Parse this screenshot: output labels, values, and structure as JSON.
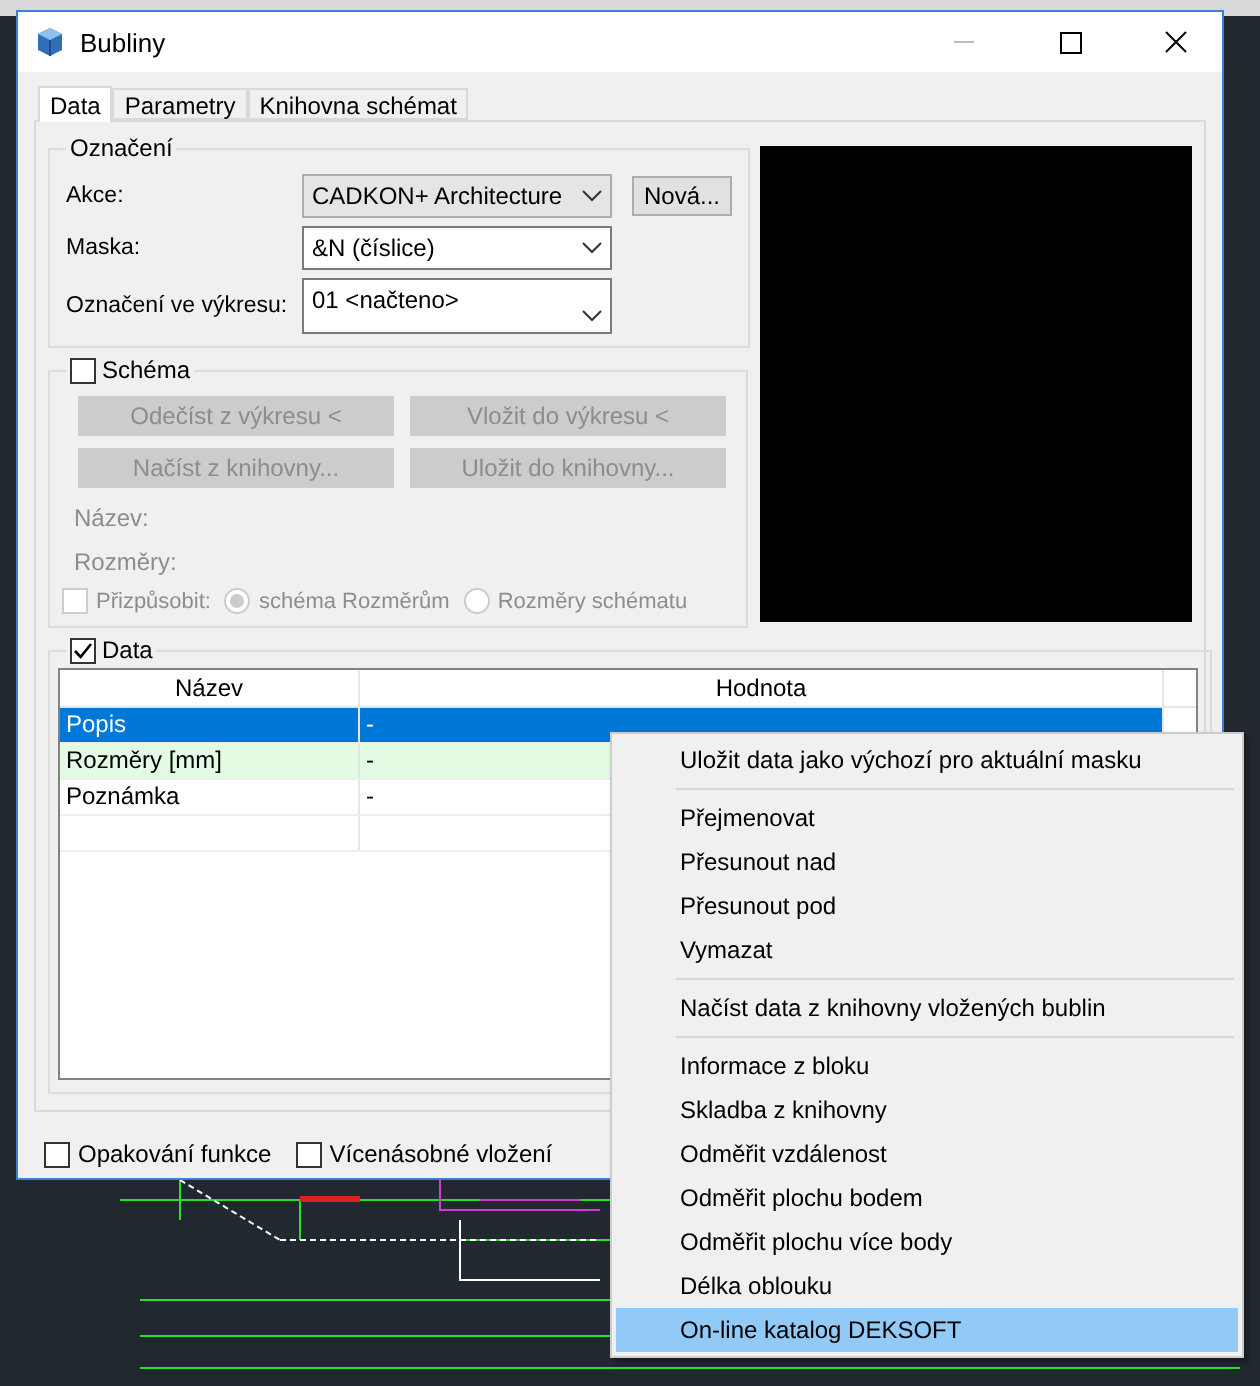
{
  "window": {
    "title": "Bubliny"
  },
  "tabs": [
    {
      "label": "Data",
      "selected": true
    },
    {
      "label": "Parametry",
      "selected": false
    },
    {
      "label": "Knihovna schémat",
      "selected": false
    }
  ],
  "oznaceni": {
    "title": "Označení",
    "fields": [
      {
        "label": "Akce:",
        "value": "CADKON+ Architecture",
        "kind": "combo"
      },
      {
        "label": "Maska:",
        "value": "&N (číslice)",
        "kind": "dropdown"
      },
      {
        "label": "Označení ve výkresu:",
        "value": "01 <načteno>",
        "kind": "tall"
      }
    ],
    "new_button": "Nová..."
  },
  "schema": {
    "title": "Schéma",
    "checked": false,
    "disabled": true,
    "buttons": [
      "Odečíst z výkresu <",
      "Vložit do výkresu <",
      "Načíst z knihovny...",
      "Uložit do knihovny..."
    ],
    "labels": [
      "Název:",
      "Rozměry:"
    ],
    "fit": {
      "label": "Přizpůsobit:",
      "checked": false
    },
    "radios": [
      {
        "label": "schéma Rozměrům",
        "selected": true
      },
      {
        "label": "Rozměry schématu",
        "selected": false
      }
    ]
  },
  "data": {
    "title": "Data",
    "checked": true,
    "columns": [
      "Název",
      "Hodnota"
    ],
    "rows": [
      {
        "name": "Popis",
        "value": "-",
        "selected": true,
        "highlighted": false
      },
      {
        "name": "Rozměry [mm]",
        "value": "-",
        "selected": false,
        "highlighted": true
      },
      {
        "name": "Poznámka",
        "value": "-",
        "selected": false,
        "highlighted": false
      }
    ]
  },
  "options": [
    {
      "label": "Opakování funkce",
      "checked": false
    },
    {
      "label": "Vícenásobné vložení",
      "checked": false
    }
  ],
  "context_menu": {
    "groups": [
      [
        {
          "label": "Uložit data jako výchozí pro aktuální masku",
          "selected": false
        }
      ],
      [
        {
          "label": "Přejmenovat",
          "selected": false
        },
        {
          "label": "Přesunout nad",
          "selected": false
        },
        {
          "label": "Přesunout pod",
          "selected": false
        },
        {
          "label": "Vymazat",
          "selected": false
        }
      ],
      [
        {
          "label": "Načíst data z knihovny vložených bublin",
          "selected": false
        }
      ],
      [
        {
          "label": "Informace z bloku",
          "selected": false
        },
        {
          "label": "Skladba z knihovny",
          "selected": false
        },
        {
          "label": "Odměřit vzdálenost",
          "selected": false
        },
        {
          "label": "Odměřit plochu bodem",
          "selected": false
        },
        {
          "label": "Odměřit plochu více body",
          "selected": false
        },
        {
          "label": "Délka oblouku",
          "selected": false
        },
        {
          "label": "On-line katalog DEKSOFT",
          "selected": true
        }
      ]
    ]
  }
}
